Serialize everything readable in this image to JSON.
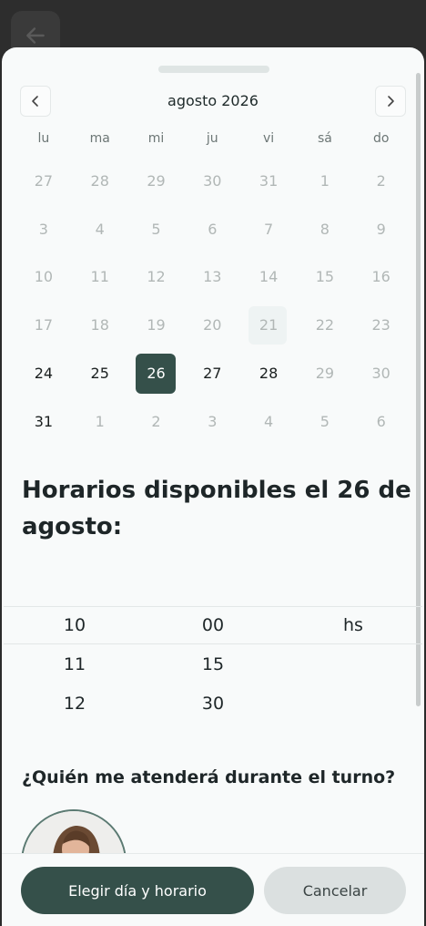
{
  "calendar": {
    "month_label": "agosto 2026",
    "weekdays": [
      "lu",
      "ma",
      "mi",
      "ju",
      "vi",
      "sá",
      "do"
    ],
    "weeks": [
      [
        {
          "d": "27",
          "s": "off"
        },
        {
          "d": "28",
          "s": "off"
        },
        {
          "d": "29",
          "s": "off"
        },
        {
          "d": "30",
          "s": "off"
        },
        {
          "d": "31",
          "s": "off"
        },
        {
          "d": "1",
          "s": "off"
        },
        {
          "d": "2",
          "s": "off"
        }
      ],
      [
        {
          "d": "3",
          "s": "off"
        },
        {
          "d": "4",
          "s": "off"
        },
        {
          "d": "5",
          "s": "off"
        },
        {
          "d": "6",
          "s": "off"
        },
        {
          "d": "7",
          "s": "off"
        },
        {
          "d": "8",
          "s": "off"
        },
        {
          "d": "9",
          "s": "off"
        }
      ],
      [
        {
          "d": "10",
          "s": "off"
        },
        {
          "d": "11",
          "s": "off"
        },
        {
          "d": "12",
          "s": "off"
        },
        {
          "d": "13",
          "s": "off"
        },
        {
          "d": "14",
          "s": "off"
        },
        {
          "d": "15",
          "s": "off"
        },
        {
          "d": "16",
          "s": "off"
        }
      ],
      [
        {
          "d": "17",
          "s": "off"
        },
        {
          "d": "18",
          "s": "off"
        },
        {
          "d": "19",
          "s": "off"
        },
        {
          "d": "20",
          "s": "off"
        },
        {
          "d": "21",
          "s": "today"
        },
        {
          "d": "22",
          "s": "off"
        },
        {
          "d": "23",
          "s": "off"
        }
      ],
      [
        {
          "d": "24",
          "s": "active"
        },
        {
          "d": "25",
          "s": "active"
        },
        {
          "d": "26",
          "s": "selected"
        },
        {
          "d": "27",
          "s": "active"
        },
        {
          "d": "28",
          "s": "active"
        },
        {
          "d": "29",
          "s": "off"
        },
        {
          "d": "30",
          "s": "off"
        }
      ],
      [
        {
          "d": "31",
          "s": "active"
        },
        {
          "d": "1",
          "s": "off"
        },
        {
          "d": "2",
          "s": "off"
        },
        {
          "d": "3",
          "s": "off"
        },
        {
          "d": "4",
          "s": "off"
        },
        {
          "d": "5",
          "s": "off"
        },
        {
          "d": "6",
          "s": "off"
        }
      ]
    ]
  },
  "schedule": {
    "title": "Horarios disponibles el 26 de agosto:",
    "hours": [
      "10",
      "11",
      "12"
    ],
    "minutes": [
      "00",
      "15",
      "30"
    ],
    "unit": "hs"
  },
  "staff": {
    "question": "¿Quién me atenderá durante el turno?"
  },
  "footer": {
    "primary_label": "Elegir día y horario",
    "secondary_label": "Cancelar"
  },
  "colors": {
    "accent": "#35504a",
    "secondary": "#dbe0e0"
  }
}
